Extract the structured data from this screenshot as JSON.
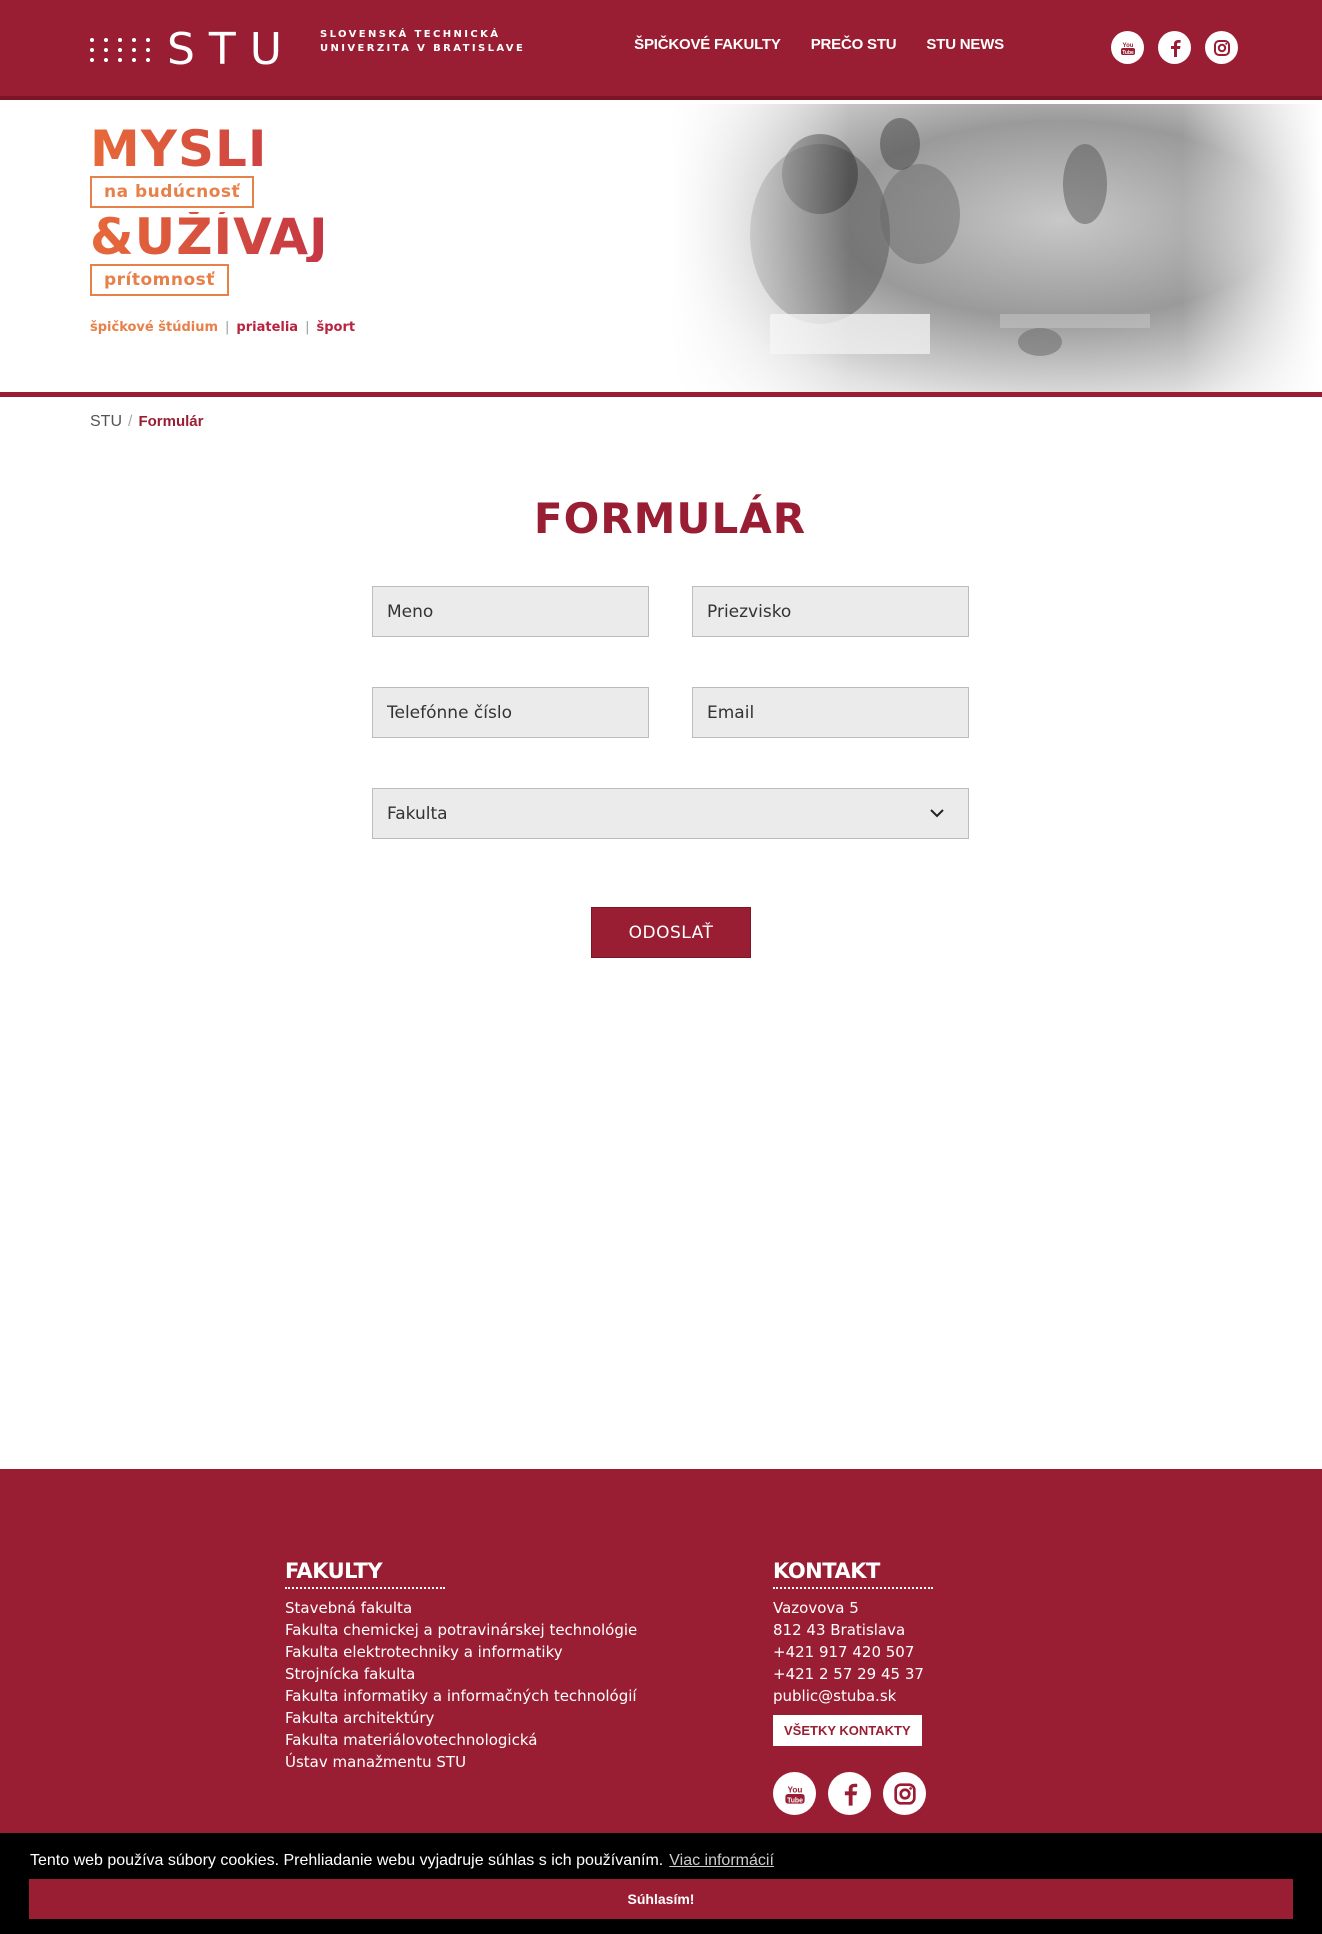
{
  "header": {
    "logo_text": "STU",
    "logo_sub_line1": "SLOVENSKÁ TECHNICKÁ",
    "logo_sub_line2": "UNIVERZITA V BRATISLAVE",
    "nav": [
      {
        "label": "ŠPIČKOVÉ FAKULTY"
      },
      {
        "label": "PREČO STU"
      },
      {
        "label": "STU NEWS"
      }
    ],
    "social": [
      {
        "icon": "youtube-icon",
        "glyph": "You\nTube"
      },
      {
        "icon": "facebook-icon",
        "glyph": "f"
      },
      {
        "icon": "instagram-icon",
        "glyph": "◎"
      }
    ]
  },
  "hero": {
    "line1": "MYSLI",
    "bubble1": "na budúcnosť",
    "line2": "&UŽÍVAJ",
    "bubble2": "prítomnosť",
    "tag1": "špičkové štúdium",
    "tag2": "priatelia",
    "tag3": "šport",
    "separator": "|"
  },
  "breadcrumb": {
    "home": "STU",
    "separator": "/",
    "current": "Formulár"
  },
  "form": {
    "title": "FORMULÁR",
    "first_name_placeholder": "Meno",
    "last_name_placeholder": "Priezvisko",
    "phone_placeholder": "Telefónne číslo",
    "email_placeholder": "Email",
    "faculty_select": "Fakulta",
    "submit_label": "ODOSLAŤ"
  },
  "footer": {
    "faculties_heading": "FAKULTY",
    "faculties": [
      "Stavebná fakulta",
      "Fakulta chemickej a potravinárskej technológie",
      "Fakulta elektrotechniky a informatiky",
      "Strojnícka fakulta",
      "Fakulta informatiky a informačných technológií",
      "Fakulta architektúry",
      "Fakulta materiálovotechnologická",
      "Ústav manažmentu STU"
    ],
    "contact_heading": "KONTAKT",
    "contact": [
      "Vazovova 5",
      "812 43 Bratislava",
      "+421 917 420 507",
      "+421 2 57 29 45 37",
      "public@stuba.sk"
    ],
    "contact_button": "VŠETKY KONTAKTY"
  },
  "cookie": {
    "text": "Tento web používa súbory cookies. Prehliadanie webu vyjadruje súhlas s ich používaním.",
    "link": "Viac informácií",
    "accept": "Súhlasím!"
  },
  "colors": {
    "brand": "#9a1e33",
    "accent_orange": "#e8804a"
  }
}
